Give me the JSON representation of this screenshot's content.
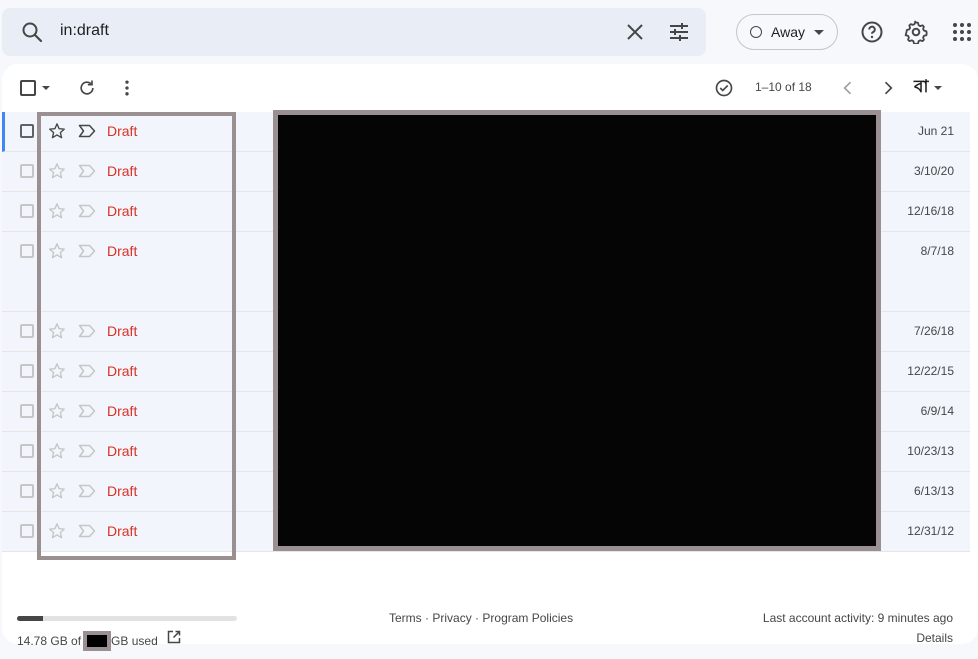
{
  "search": {
    "value": "in:draft"
  },
  "status": {
    "label": "Away"
  },
  "toolbar": {
    "pager": "1–10 of 18",
    "lang": "বা"
  },
  "rows": [
    {
      "label": "Draft",
      "date": "Jun 21"
    },
    {
      "label": "Draft",
      "date": "3/10/20"
    },
    {
      "label": "Draft",
      "date": "12/16/18"
    },
    {
      "label": "Draft",
      "date": "8/7/18"
    },
    {
      "label": "Draft",
      "date": "7/26/18"
    },
    {
      "label": "Draft",
      "date": "12/22/15"
    },
    {
      "label": "Draft",
      "date": "6/9/14"
    },
    {
      "label": "Draft",
      "date": "10/23/13"
    },
    {
      "label": "Draft",
      "date": "6/13/13"
    },
    {
      "label": "Draft",
      "date": "12/31/12"
    }
  ],
  "footer": {
    "storage_used": "14.78 GB of",
    "storage_unit": "GB used",
    "storage_fraction": 0.12,
    "terms": "Terms",
    "privacy": "Privacy",
    "policies": "Program Policies",
    "sep": "·",
    "activity": "Last account activity: 9 minutes ago",
    "details": "Details"
  },
  "colors": {
    "draft": "#d93025",
    "accent": "#4285f4",
    "overlay_border": "#9b9091"
  }
}
